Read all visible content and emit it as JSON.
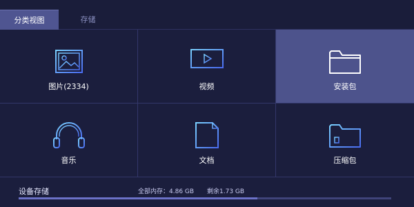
{
  "tabs": [
    {
      "label": "分类视图",
      "active": true
    },
    {
      "label": "存储",
      "active": false
    }
  ],
  "categories": [
    {
      "label": "图片(2334)",
      "icon": "image-icon"
    },
    {
      "label": "视频",
      "icon": "video-monitor-icon"
    },
    {
      "label": "安装包",
      "icon": "folder-icon",
      "highlighted": true
    },
    {
      "label": "音乐",
      "icon": "headphones-icon"
    },
    {
      "label": "文档",
      "icon": "document-icon"
    },
    {
      "label": "压缩包",
      "icon": "zip-folder-icon"
    }
  ],
  "storage": {
    "title": "设备存储",
    "total_text": "全部内存：4.86 GB",
    "remaining_text": "剩余1.73 GB",
    "used_fraction": 0.64
  },
  "colors": {
    "background": "#1b1e3d",
    "accent": "#4f5591",
    "icon_stroke": "#5aa8f0",
    "progress": "#6c72c8"
  }
}
